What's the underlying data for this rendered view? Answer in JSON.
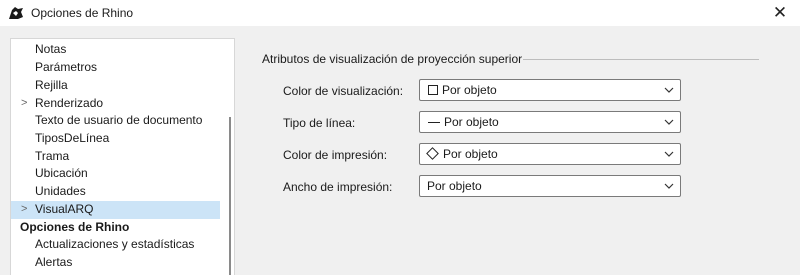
{
  "window": {
    "title": "Opciones de Rhino",
    "close_symbol": "✕"
  },
  "sidebar": {
    "items": [
      {
        "label": "Notas"
      },
      {
        "label": "Parámetros"
      },
      {
        "label": "Rejilla"
      },
      {
        "label": "Renderizado",
        "expandable": true
      },
      {
        "label": "Texto de usuario de documento"
      },
      {
        "label": "TiposDeLínea"
      },
      {
        "label": "Trama"
      },
      {
        "label": "Ubicación"
      },
      {
        "label": "Unidades"
      },
      {
        "label": "VisualARQ",
        "expandable": true,
        "selected": true
      },
      {
        "label": "Opciones de Rhino",
        "header": true
      },
      {
        "label": "Actualizaciones y estadísticas"
      },
      {
        "label": "Alertas"
      }
    ],
    "chevron_symbol": ">"
  },
  "main": {
    "group_title": "Atributos de visualización de proyección superior",
    "rows": [
      {
        "label": "Color de visualización:",
        "value": "Por objeto",
        "swatch": "square"
      },
      {
        "label": "Tipo de línea:",
        "value": "Por objeto",
        "swatch": "line"
      },
      {
        "label": "Color de impresión:",
        "value": "Por objeto",
        "swatch": "diamond"
      },
      {
        "label": "Ancho de impresión:",
        "value": "Por objeto",
        "swatch": "none"
      }
    ]
  },
  "colors": {
    "selection": "#cce4f7",
    "background": "#f0f0f0",
    "panel": "#ffffff"
  }
}
